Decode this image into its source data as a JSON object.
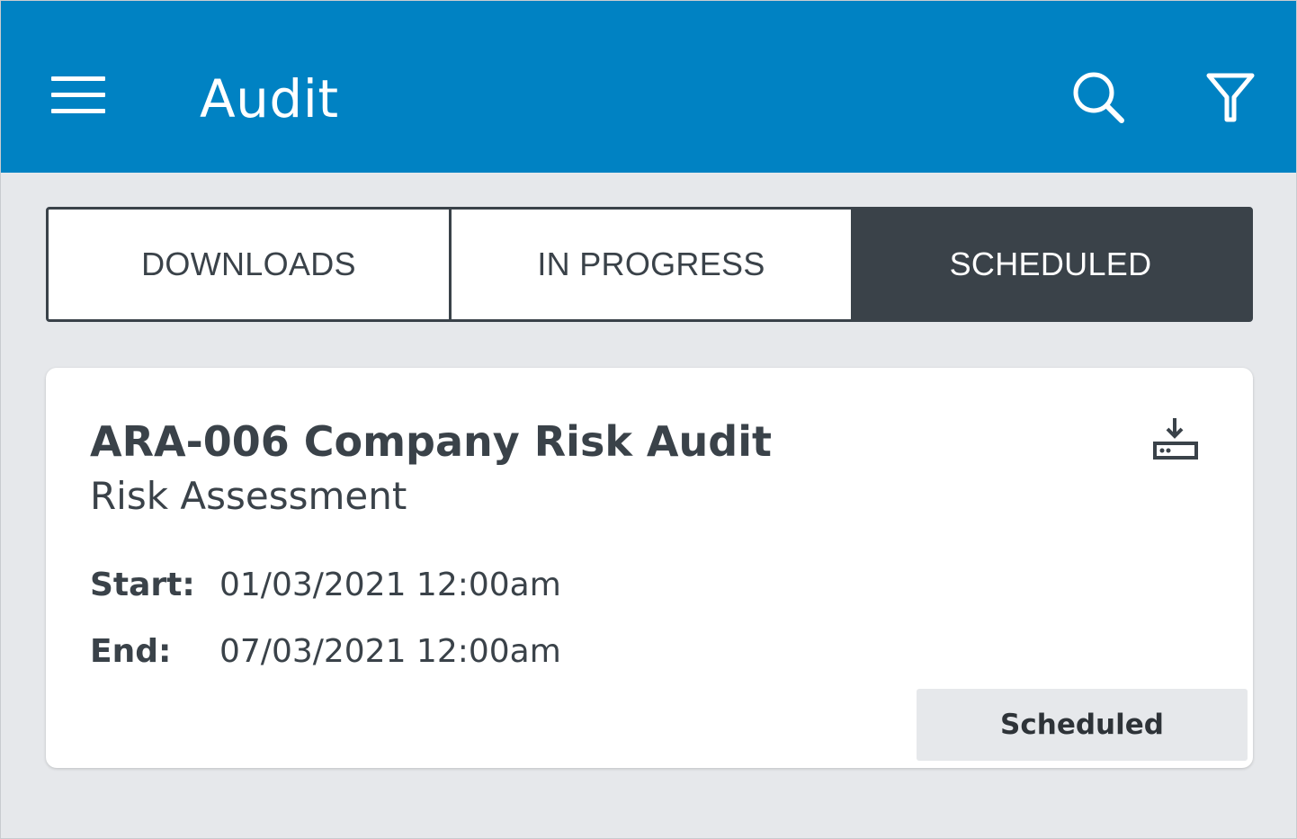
{
  "appbar": {
    "title": "Audit",
    "menu_icon": "hamburger-menu-icon",
    "search_icon": "search-icon",
    "filter_icon": "filter-funnel-icon",
    "background_color": "#0082c3"
  },
  "tabs": [
    {
      "label": "DOWNLOADS",
      "selected": false
    },
    {
      "label": "IN PROGRESS",
      "selected": false
    },
    {
      "label": "SCHEDULED",
      "selected": true
    }
  ],
  "audit_card": {
    "title": "ARA-006 Company Risk Audit",
    "subtitle": "Risk Assessment",
    "download_icon": "download-to-device-icon",
    "start_label": "Start:",
    "start_value": "01/03/2021 12:00am",
    "end_label": "End:",
    "end_value": "07/03/2021 12:00am",
    "status_label": "Scheduled"
  },
  "colors": {
    "accent": "#0082c3",
    "dark": "#3a4249",
    "page_background": "#e6e8eb"
  }
}
